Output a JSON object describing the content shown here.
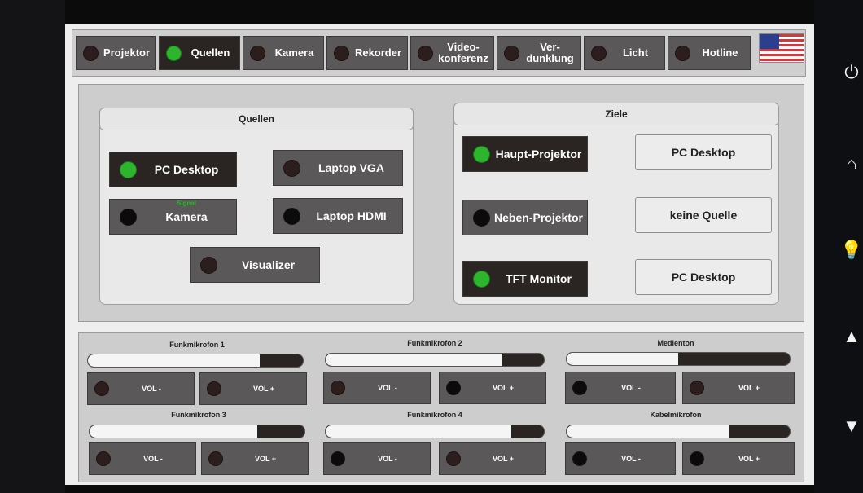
{
  "nav": [
    {
      "label": "Projektor",
      "led": "dark"
    },
    {
      "label": "Quellen",
      "led": "green"
    },
    {
      "label": "Kamera",
      "led": "dark"
    },
    {
      "label": "Rekorder",
      "led": "dark"
    },
    {
      "label": "Video-\nkonferenz",
      "led": "dark"
    },
    {
      "label": "Ver-\ndunklung",
      "led": "dark"
    },
    {
      "label": "Licht",
      "led": "dark"
    },
    {
      "label": "Hotline",
      "led": "dark"
    }
  ],
  "language_flag": "us-flag-icon",
  "sources": {
    "title": "Quellen",
    "items": [
      {
        "label": "PC Desktop",
        "led": "green"
      },
      {
        "label": "Laptop VGA",
        "led": "dark"
      },
      {
        "label": "Kamera",
        "led": "black",
        "signal": "Signal"
      },
      {
        "label": "Laptop HDMI",
        "led": "black"
      },
      {
        "label": "Visualizer",
        "led": "dark"
      }
    ]
  },
  "targets": {
    "title": "Ziele",
    "items": [
      {
        "label": "Haupt-Projektor",
        "led": "green",
        "source": "PC Desktop"
      },
      {
        "label": "Neben-Projektor",
        "led": "black",
        "source": "keine Quelle"
      },
      {
        "label": "TFT Monitor",
        "led": "green",
        "source": "PC Desktop"
      }
    ]
  },
  "audio": [
    {
      "title": "Funkmikrofon 1",
      "level": 0.8,
      "minus": "VOL -",
      "plus": "VOL +",
      "led_minus": "dark",
      "led_plus": "dark"
    },
    {
      "title": "Funkmikrofon 2",
      "level": 0.81,
      "minus": "VOL -",
      "plus": "VOL +",
      "led_minus": "dark",
      "led_plus": "black"
    },
    {
      "title": "Medienton",
      "level": 0.5,
      "minus": "VOL -",
      "plus": "VOL +",
      "led_minus": "black",
      "led_plus": "dark"
    },
    {
      "title": "Funkmikrofon 3",
      "level": 0.78,
      "minus": "VOL -",
      "plus": "VOL +",
      "led_minus": "dark",
      "led_plus": "dark"
    },
    {
      "title": "Funkmikrofon 4",
      "level": 0.85,
      "minus": "VOL -",
      "plus": "VOL +",
      "led_minus": "black",
      "led_plus": "dark"
    },
    {
      "title": "Kabelmikrofon",
      "level": 0.73,
      "minus": "VOL -",
      "plus": "VOL +",
      "led_minus": "black",
      "led_plus": "black"
    }
  ],
  "side_icons": [
    "power-icon",
    "home-icon",
    "lightbulb-icon",
    "up-arrow-icon",
    "down-arrow-icon"
  ],
  "colors": {
    "led_green": "#2eb52e",
    "button_dark": "#2a2523",
    "button_gray": "#5a5858"
  }
}
